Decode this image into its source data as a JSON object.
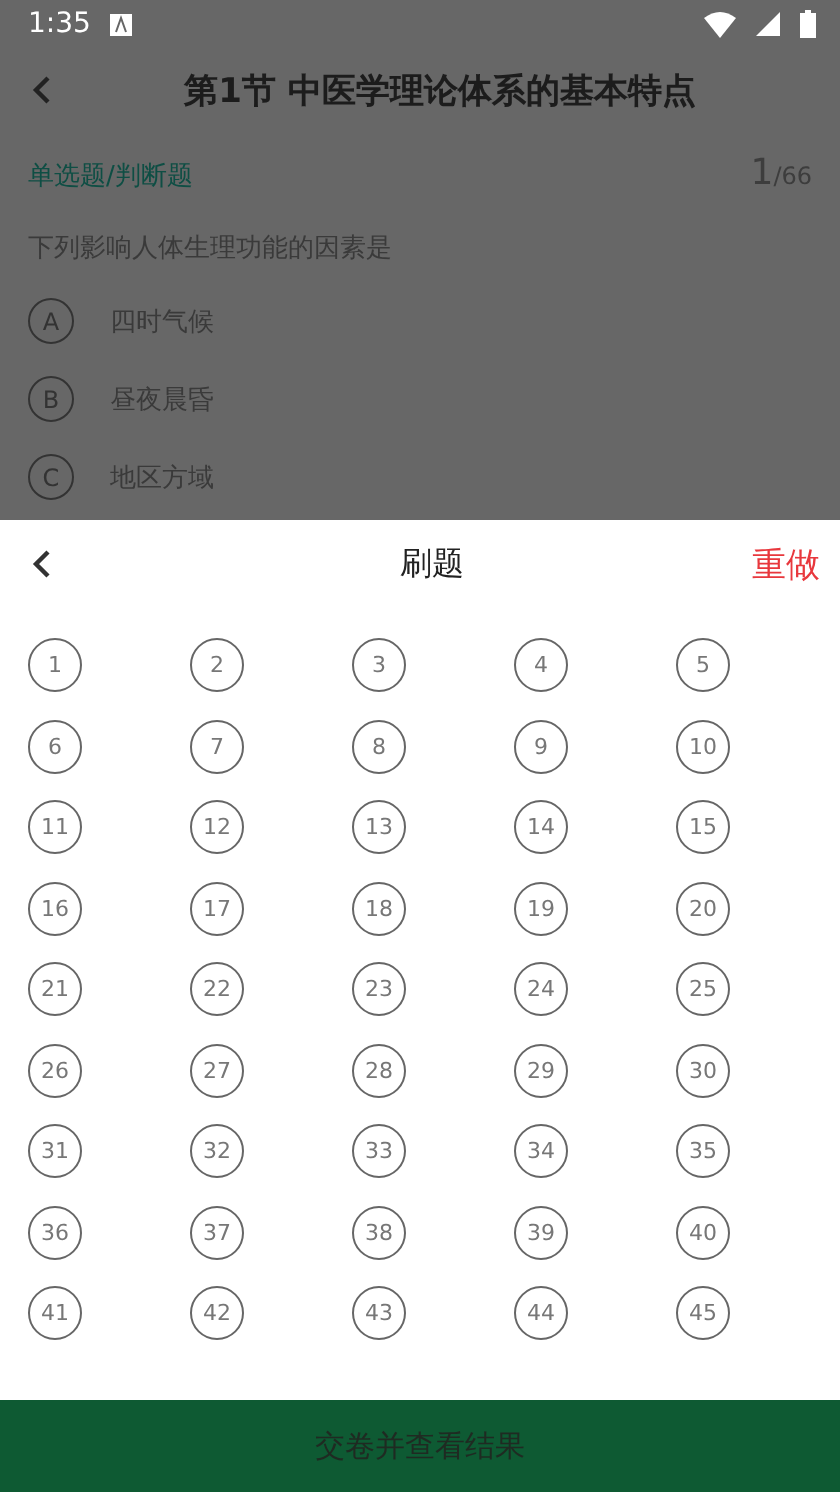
{
  "status_bar": {
    "time": "1:35"
  },
  "header": {
    "title": "第1节 中医学理论体系的基本特点"
  },
  "question": {
    "type": "单选题/判断题",
    "current": "1",
    "total": "/66",
    "text": "下列影响人体生理功能的因素是",
    "options": [
      {
        "letter": "A",
        "text": "四时气候"
      },
      {
        "letter": "B",
        "text": "昼夜晨昏"
      },
      {
        "letter": "C",
        "text": "地区方域"
      }
    ]
  },
  "sheet": {
    "title": "刷题",
    "redo": "重做",
    "numbers": [
      "1",
      "2",
      "3",
      "4",
      "5",
      "6",
      "7",
      "8",
      "9",
      "10",
      "11",
      "12",
      "13",
      "14",
      "15",
      "16",
      "17",
      "18",
      "19",
      "20",
      "21",
      "22",
      "23",
      "24",
      "25",
      "26",
      "27",
      "28",
      "29",
      "30",
      "31",
      "32",
      "33",
      "34",
      "35",
      "36",
      "37",
      "38",
      "39",
      "40",
      "41",
      "42",
      "43",
      "44",
      "45"
    ]
  },
  "submit": "交卷并查看结果"
}
